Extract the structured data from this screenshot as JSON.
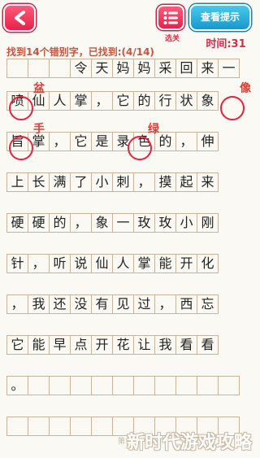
{
  "header": {
    "back_icon": "back-arrow-icon",
    "level_icon": "list-menu-icon",
    "level_label": "选关",
    "hint_label": "查看提示",
    "timer": "时间:31",
    "progress": "找到14个错别字，已找到:(4/14)"
  },
  "grid": {
    "rows": [
      [
        "",
        "",
        "",
        "令",
        "天",
        "妈",
        "妈",
        "采",
        "回",
        "来",
        "一"
      ],
      [
        "喷",
        "仙",
        "人",
        "掌",
        "，",
        "它",
        "的",
        "行",
        "状",
        "象"
      ],
      [
        "旨",
        "掌",
        "，",
        "它",
        "是",
        "录",
        "色",
        "的",
        "，",
        "伸"
      ],
      [
        "上",
        "长",
        "满",
        "了",
        "小",
        "刺",
        "，",
        "摸",
        "起",
        "来"
      ],
      [
        "硬",
        "硬",
        "的",
        "，",
        "象",
        "一",
        "玫",
        "玫",
        "小",
        "刚"
      ],
      [
        "针",
        "，",
        "听",
        "说",
        "仙",
        "人",
        "掌",
        "能",
        "开",
        "化"
      ],
      [
        "，",
        "我",
        "还",
        "没",
        "有",
        "见",
        "过",
        "，",
        "西",
        "忘"
      ],
      [
        "它",
        "能",
        "早",
        "点",
        "开",
        "花",
        "让",
        "我",
        "看",
        "看"
      ],
      [
        "。",
        "",
        "",
        "",
        "",
        "",
        "",
        "",
        "",
        "",
        ""
      ],
      [
        "",
        "",
        "",
        "",
        "",
        "",
        "",
        "",
        "",
        "",
        ""
      ]
    ]
  },
  "marks": {
    "corrections": [
      "盆",
      "像",
      "手",
      "绿"
    ]
  },
  "colors": {
    "accent_red": "#e8204a",
    "hint_blue": "#1898c9",
    "circle_red": "#e8213c",
    "grid_line": "#c5b39d",
    "background": "#fbf9f3"
  },
  "watermark": {
    "prefix": "第",
    "text": "新时代游戏攻略"
  }
}
